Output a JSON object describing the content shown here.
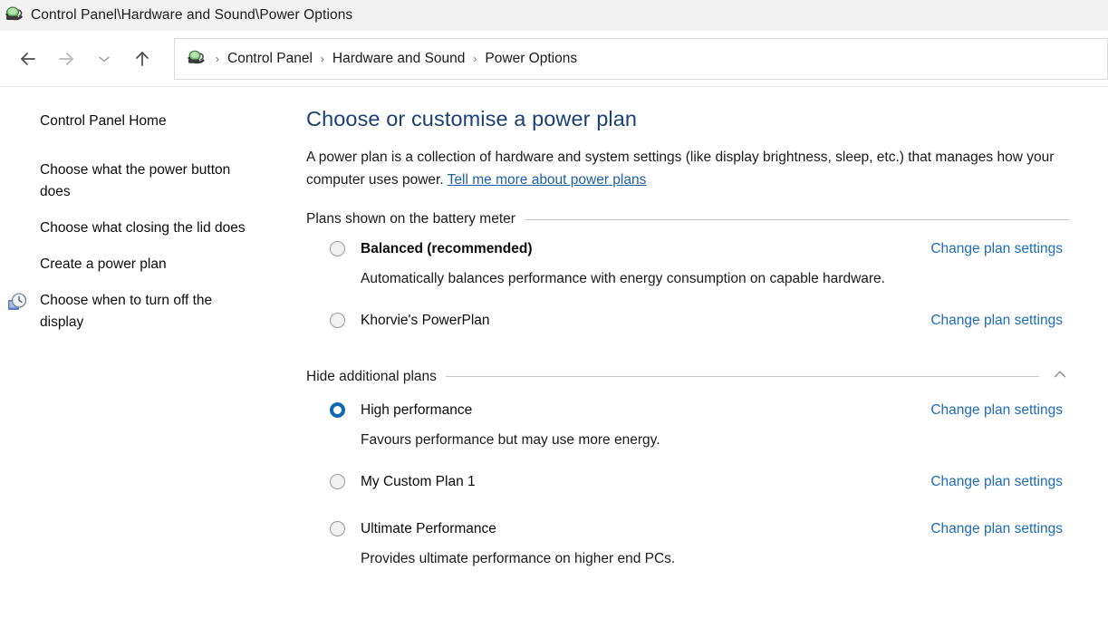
{
  "window": {
    "title": "Control Panel\\Hardware and Sound\\Power Options",
    "icon": "power-plug-icon"
  },
  "nav": {
    "back_icon": "back-arrow-icon",
    "forward_icon": "forward-arrow-icon",
    "recent_icon": "chevron-down-icon",
    "up_icon": "up-arrow-icon",
    "address_icon": "power-plug-icon",
    "breadcrumbs": [
      {
        "label": "Control Panel"
      },
      {
        "label": "Hardware and Sound"
      },
      {
        "label": "Power Options"
      }
    ],
    "separator": "›"
  },
  "sidebar": {
    "items": [
      {
        "label": "Control Panel Home",
        "icon": null
      },
      {
        "label": "Choose what the power button does",
        "icon": null
      },
      {
        "label": "Choose what closing the lid does",
        "icon": null
      },
      {
        "label": "Create a power plan",
        "icon": null
      },
      {
        "label": "Choose when to turn off the display",
        "icon": "clock-display-icon"
      }
    ]
  },
  "content": {
    "title": "Choose or customise a power plan",
    "description_part1": "A power plan is a collection of hardware and system settings (like display brightness, sleep, etc.) that manages how your computer uses power. ",
    "description_link": "Tell me more about power plans",
    "sections": [
      {
        "label": "Plans shown on the battery meter",
        "toggle_icon": null,
        "plans": [
          {
            "name": "Balanced (recommended)",
            "bold": true,
            "selected": false,
            "description": "Automatically balances performance with energy consumption on capable hardware.",
            "action_label": "Change plan settings"
          },
          {
            "name": "Khorvie's PowerPlan",
            "bold": false,
            "selected": false,
            "description": "",
            "action_label": "Change plan settings"
          }
        ]
      },
      {
        "label": "Hide additional plans",
        "toggle_icon": "chevron-up-icon",
        "plans": [
          {
            "name": "High performance",
            "bold": false,
            "selected": true,
            "description": "Favours performance but may use more energy.",
            "action_label": "Change plan settings"
          },
          {
            "name": "My Custom Plan 1",
            "bold": false,
            "selected": false,
            "description": "",
            "action_label": "Change plan settings"
          },
          {
            "name": "Ultimate Performance",
            "bold": false,
            "selected": false,
            "description": "Provides ultimate performance on higher end PCs.",
            "action_label": "Change plan settings"
          }
        ]
      }
    ]
  },
  "colors": {
    "heading": "#1c3f77",
    "link": "#1f6bb8",
    "radio_selected": "#1069b5",
    "titlebar_bg": "#f2f2f2",
    "rule": "#c8c8c8"
  }
}
